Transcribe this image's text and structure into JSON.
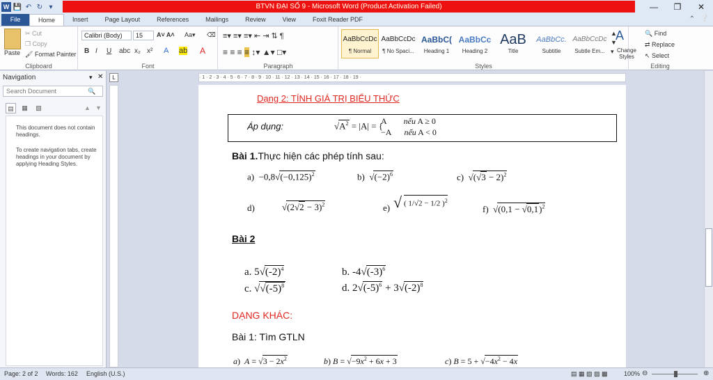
{
  "window": {
    "title": "BTVN ĐẠI SỐ 9 - Microsoft Word (Product Activation Failed)"
  },
  "tabs": [
    "File",
    "Home",
    "Insert",
    "Page Layout",
    "References",
    "Mailings",
    "Review",
    "View",
    "Foxit Reader PDF"
  ],
  "clipboard": {
    "paste": "Paste",
    "cut": "Cut",
    "copy": "Copy",
    "format_painter": "Format Painter",
    "label": "Clipboard"
  },
  "font": {
    "name": "Calibri (Body)",
    "size": "15",
    "label": "Font"
  },
  "paragraph": {
    "label": "Paragraph"
  },
  "styles": {
    "label": "Styles",
    "items": [
      {
        "preview": "AaBbCcDc",
        "name": "¶ Normal"
      },
      {
        "preview": "AaBbCcDc",
        "name": "¶ No Spaci..."
      },
      {
        "preview": "AaBbC(",
        "name": "Heading 1"
      },
      {
        "preview": "AaBbCc",
        "name": "Heading 2"
      },
      {
        "preview": "AaB",
        "name": "Title"
      },
      {
        "preview": "AaBbCc.",
        "name": "Subtitle"
      },
      {
        "preview": "AaBbCcDc",
        "name": "Subtle Em..."
      }
    ],
    "change": "Change Styles"
  },
  "editing": {
    "find": "Find",
    "replace": "Replace",
    "select": "Select",
    "label": "Editing"
  },
  "nav": {
    "title": "Navigation",
    "search_placeholder": "Search Document",
    "no_headings": "This document does not contain headings.",
    "hint": "To create navigation tabs, create headings in your document by applying Heading Styles."
  },
  "ruler": "· 1 · 2 · 3 · 4 · 5 · 6 · 7 · 8 · 9 · 10 · 11 · 12 · 13 · 14 · 15 · 16 · 17 · 18 · 19 ·",
  "doc": {
    "heading": "Dạng 2: TÍNH GIÁ TRỊ BIỂU THỨC",
    "apdung": "Áp dụng:",
    "bai1": "Bài 1.",
    "bai1_text": "Thực hiện các phép tính sau:",
    "bai2": "Bài 2",
    "dangkhac": "DẠNG KHÁC:",
    "bai1b": "Bài 1:  Tìm GTLN"
  },
  "status": {
    "page": "Page: 2 of 2",
    "words": "Words: 162",
    "lang": "English (U.S.)",
    "zoom": "100%"
  }
}
